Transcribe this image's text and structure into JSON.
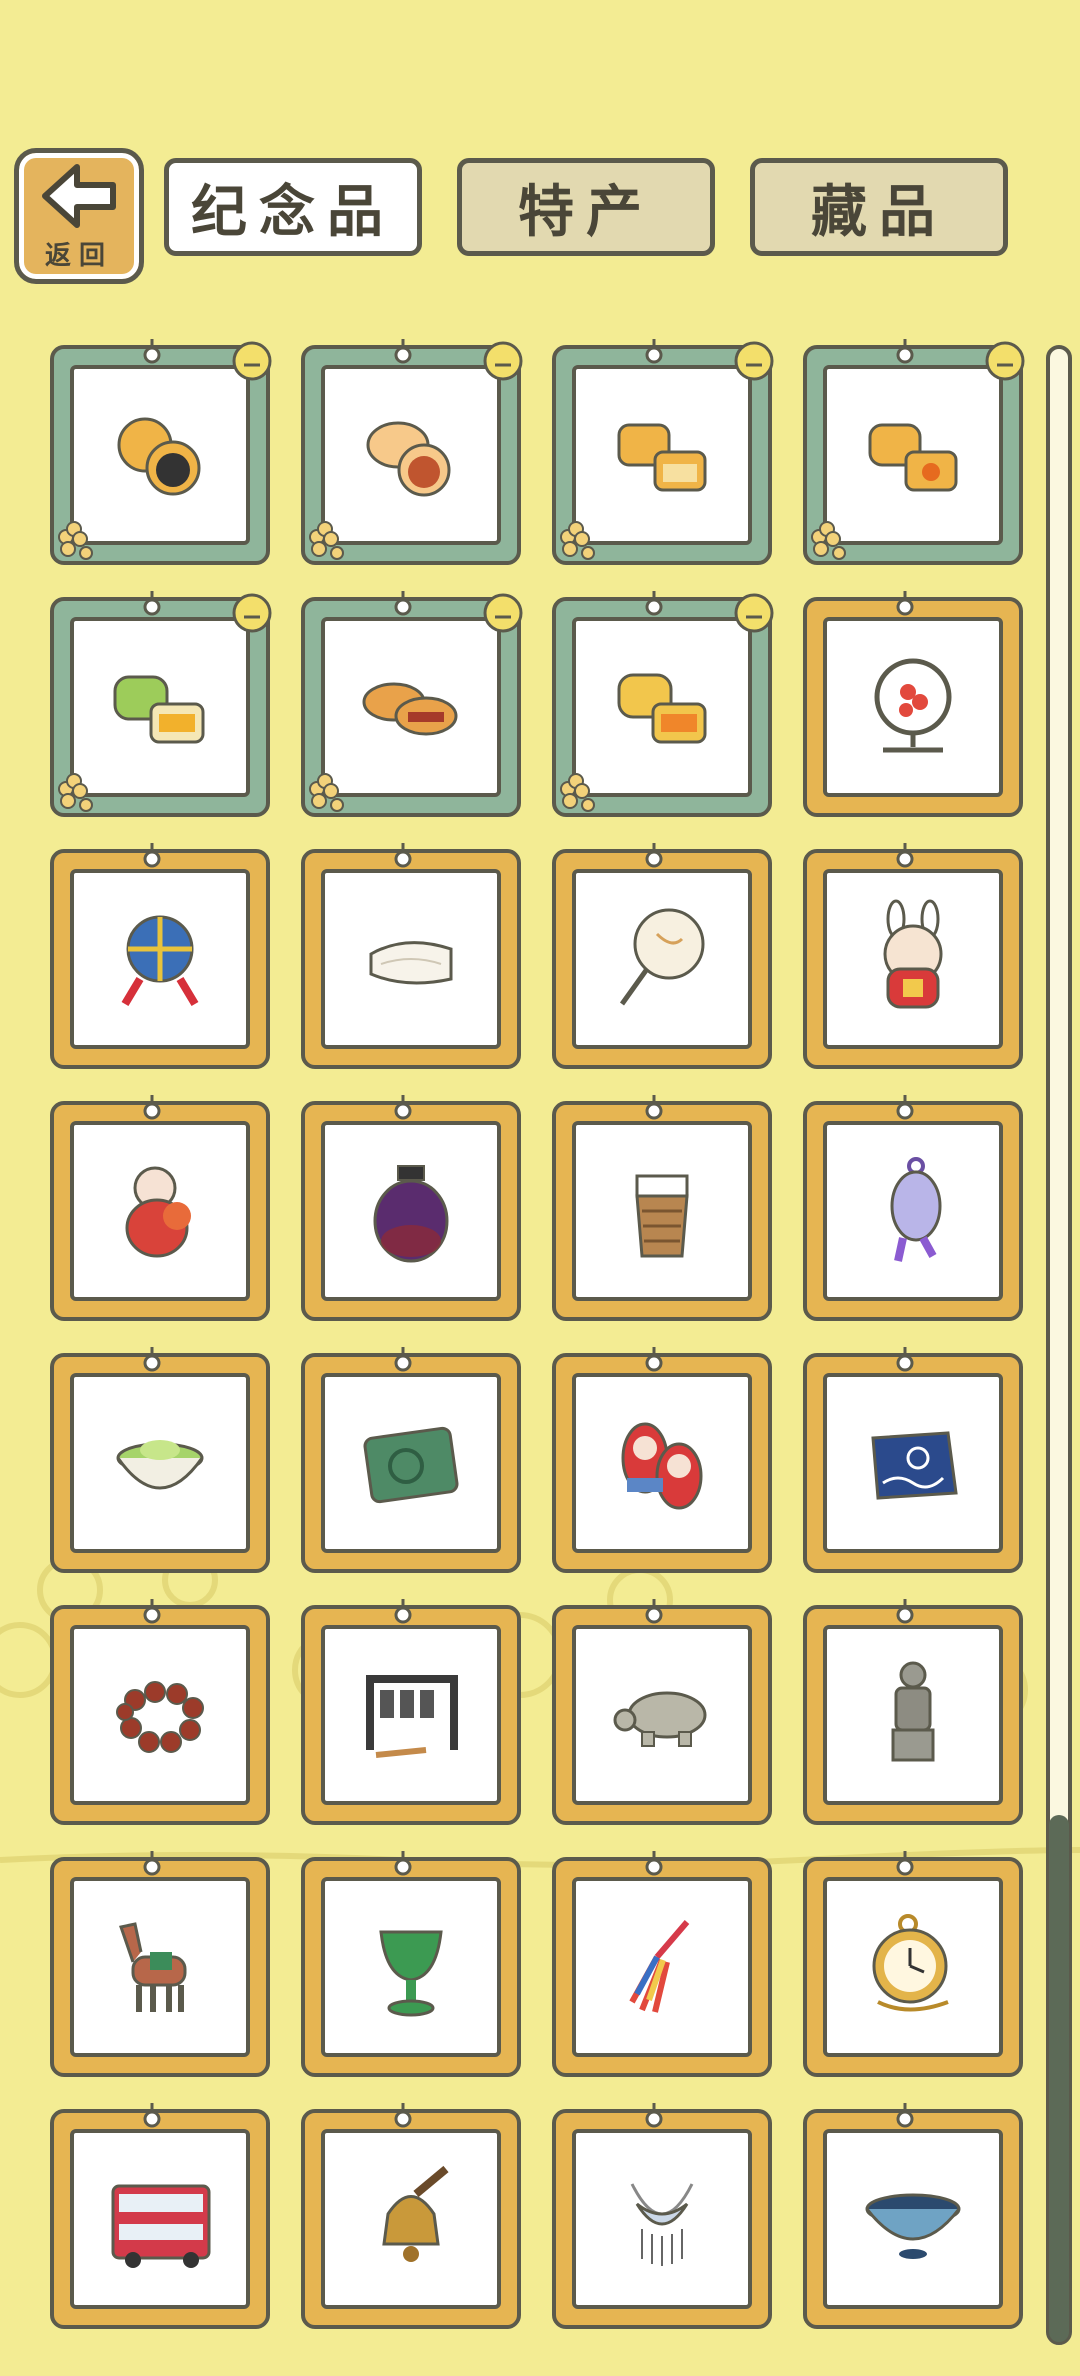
{
  "header": {
    "back_label": "返回",
    "tabs": [
      {
        "label": "纪念品",
        "active": true
      },
      {
        "label": "特产",
        "active": false
      },
      {
        "label": "藏品",
        "active": false
      }
    ]
  },
  "colors": {
    "background": "#f3ec93",
    "wood_frame": "#e6b552",
    "jade_frame": "#8fb59b",
    "outline": "#5b5a4c"
  },
  "items": [
    {
      "name": "mooncake-lotus-icon",
      "frame": "jade"
    },
    {
      "name": "mooncake-red-bean-icon",
      "frame": "jade"
    },
    {
      "name": "mooncake-square-icon",
      "frame": "jade"
    },
    {
      "name": "mooncake-egg-yolk-icon",
      "frame": "jade"
    },
    {
      "name": "mooncake-green-tea-icon",
      "frame": "jade"
    },
    {
      "name": "mooncake-meat-icon",
      "frame": "jade"
    },
    {
      "name": "mooncake-custard-icon",
      "frame": "jade"
    },
    {
      "name": "embroidery-screen-icon",
      "frame": "wood"
    },
    {
      "name": "temari-ball-icon",
      "frame": "wood"
    },
    {
      "name": "silk-cloth-icon",
      "frame": "wood"
    },
    {
      "name": "round-fan-icon",
      "frame": "wood"
    },
    {
      "name": "rabbit-god-figurine-icon",
      "frame": "wood"
    },
    {
      "name": "clay-doll-icon",
      "frame": "wood"
    },
    {
      "name": "ceramic-jar-icon",
      "frame": "wood"
    },
    {
      "name": "bamboo-cup-icon",
      "frame": "wood"
    },
    {
      "name": "cloisonne-sachet-icon",
      "frame": "wood"
    },
    {
      "name": "matcha-bowl-icon",
      "frame": "wood"
    },
    {
      "name": "jade-inkstone-icon",
      "frame": "wood"
    },
    {
      "name": "matryoshka-dolls-icon",
      "frame": "wood"
    },
    {
      "name": "blue-batik-cloth-icon",
      "frame": "wood"
    },
    {
      "name": "prayer-beads-icon",
      "frame": "wood"
    },
    {
      "name": "chime-bells-icon",
      "frame": "wood"
    },
    {
      "name": "stone-turtle-icon",
      "frame": "wood"
    },
    {
      "name": "terracotta-warrior-icon",
      "frame": "wood"
    },
    {
      "name": "tang-horse-icon",
      "frame": "wood"
    },
    {
      "name": "jade-goblet-icon",
      "frame": "wood"
    },
    {
      "name": "chinese-knot-tassel-icon",
      "frame": "wood"
    },
    {
      "name": "pocket-watch-icon",
      "frame": "wood"
    },
    {
      "name": "double-decker-bus-icon",
      "frame": "wood"
    },
    {
      "name": "brass-bell-icon",
      "frame": "wood"
    },
    {
      "name": "silver-necklace-icon",
      "frame": "wood"
    },
    {
      "name": "tenmoku-bowl-icon",
      "frame": "wood"
    }
  ]
}
